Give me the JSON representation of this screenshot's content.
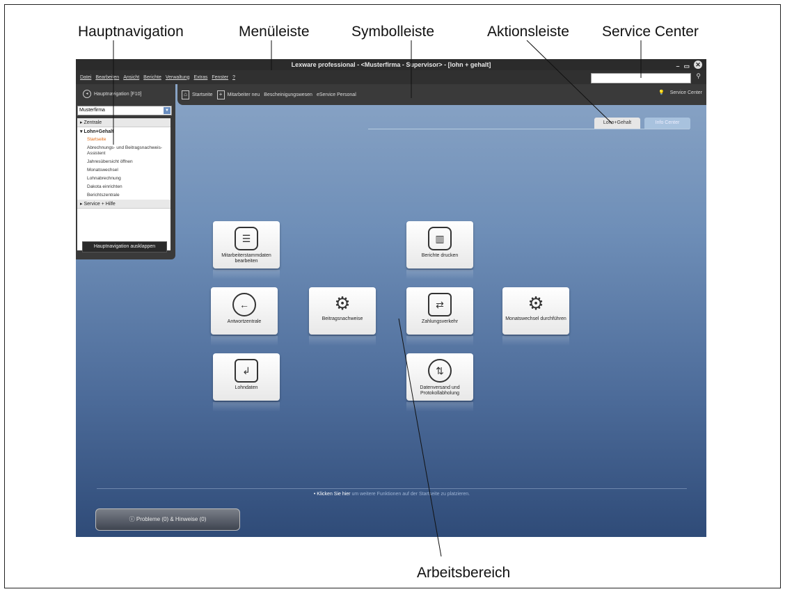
{
  "callouts": {
    "hauptnavigation": "Hauptnavigation",
    "menueleiste": "Menüleiste",
    "symbolleiste": "Symbolleiste",
    "aktionsleiste": "Aktionsleiste",
    "service_center": "Service Center",
    "arbeitsbereich": "Arbeitsbereich"
  },
  "window": {
    "title": "Lexware professional - <Musterfirma - Supervisor> - [lohn + gehalt]",
    "minimize": "–",
    "restore": "▭",
    "close": "✕"
  },
  "menubar": {
    "items": [
      "Datei",
      "Bearbeiten",
      "Ansicht",
      "Berichte",
      "Verwaltung",
      "Extras",
      "Fenster",
      "?"
    ],
    "search_placeholder": ""
  },
  "sidebar": {
    "header": "Hauptnavigation [F10]",
    "company": "Musterfirma",
    "groups": [
      {
        "label": "▸ Zentrale"
      },
      {
        "label": "▾ Lohn+Gehalt"
      }
    ],
    "items": [
      "Startseite",
      "Abrechnungs- und Beitragsnachweis-Assistent",
      "Jahresübersicht öffnen",
      "Monatswechsel",
      "Lohnabrechnung",
      "Dakota einrichten",
      "Berichtszentrale"
    ],
    "service": "▸ Service + Hilfe",
    "expand_button": "Hauptnavigation ausklappen"
  },
  "toolbar": {
    "items": [
      "Startseite",
      "Mitarbeiter neu",
      "Bescheinigungswesen",
      "eService Personal"
    ],
    "service_center": "Service Center"
  },
  "tabs": {
    "lohn_gehalt": "Lohn+Gehalt",
    "info_center": "Info Center"
  },
  "tiles": {
    "mitarbeiter": "Mitarbeiterstammdaten bearbeiten",
    "berichte": "Berichte drucken",
    "antwort": "Antwortzentrale",
    "beitrags": "Beitragsnachweise",
    "zahlung": "Zahlungsverkehr",
    "monats": "Monatswechsel durchführen",
    "lohndaten": "Lohndaten",
    "datenversand": "Datenversand und Protokollabholung"
  },
  "hint": {
    "link": "• Klicken Sie hier",
    "rest": " um weitere Funktionen auf der Startseite zu platzieren."
  },
  "problems_button": "Probleme (0) & Hinweise (0)",
  "colors": {
    "bar_dark": "#3a3a3a",
    "workspace_top": "#8ea8c8",
    "workspace_bottom": "#2f4b78",
    "active_nav": "#e06a14"
  }
}
